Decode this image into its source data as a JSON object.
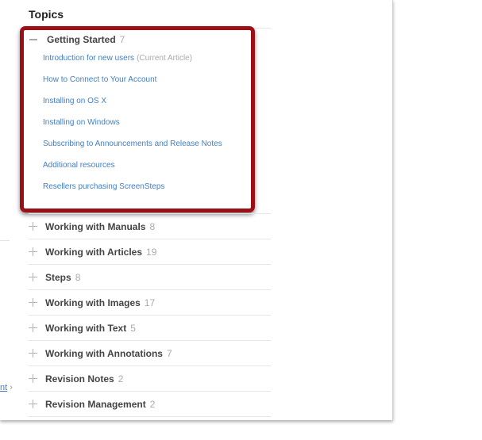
{
  "sidebar": {
    "partial_link_text": "nt",
    "chevron": "›"
  },
  "topics_header": "Topics",
  "open_topic": {
    "name": "Getting Started",
    "count": "7",
    "articles": [
      {
        "label": "Introduction for new users",
        "tag": "(Current Article)"
      },
      {
        "label": "How to Connect to Your Account",
        "tag": ""
      },
      {
        "label": "Installing on OS X",
        "tag": ""
      },
      {
        "label": "Installing on Windows",
        "tag": ""
      },
      {
        "label": "Subscribing to Announcements and Release Notes",
        "tag": ""
      },
      {
        "label": "Additional resources",
        "tag": ""
      },
      {
        "label": "Resellers purchasing ScreenSteps",
        "tag": ""
      }
    ]
  },
  "topics": [
    {
      "name": "Working with Manuals",
      "count": "8"
    },
    {
      "name": "Working with Articles",
      "count": "19"
    },
    {
      "name": "Steps",
      "count": "8"
    },
    {
      "name": "Working with Images",
      "count": "17"
    },
    {
      "name": "Working with Text",
      "count": "5"
    },
    {
      "name": "Working with Annotations",
      "count": "7"
    },
    {
      "name": "Revision Notes",
      "count": "2"
    },
    {
      "name": "Revision Management",
      "count": "2"
    }
  ],
  "colors": {
    "link": "#3f7fc4",
    "highlight_border": "#9b1016",
    "muted": "#aaaaaa"
  }
}
